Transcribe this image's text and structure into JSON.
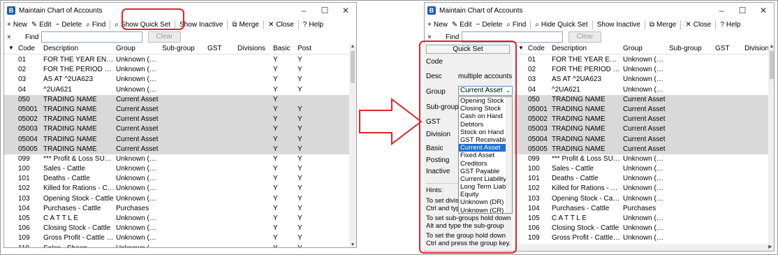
{
  "window_title": "Maintain Chart of Accounts",
  "app_icon_letter": "B",
  "toolbar_left": [
    {
      "icon": "+",
      "label": "New"
    },
    {
      "icon": "✎",
      "label": "Edit"
    },
    {
      "icon": "−",
      "label": "Delete"
    },
    {
      "icon": "⌕",
      "label": "Find"
    },
    {
      "icon": "⌕",
      "label": "Show Quick Set"
    },
    {
      "icon": "",
      "label": "Show Inactive"
    },
    {
      "icon": "⧉",
      "label": "Merge"
    },
    {
      "icon": "✕",
      "label": "Close"
    },
    {
      "icon": "?",
      "label": "Help"
    }
  ],
  "toolbar_right": [
    {
      "icon": "+",
      "label": "New"
    },
    {
      "icon": "✎",
      "label": "Edit"
    },
    {
      "icon": "−",
      "label": "Delete"
    },
    {
      "icon": "⌕",
      "label": "Find"
    },
    {
      "icon": "⌕",
      "label": "Hide Quick Set"
    },
    {
      "icon": "",
      "label": "Show Inactive"
    },
    {
      "icon": "⧉",
      "label": "Merge"
    },
    {
      "icon": "✕",
      "label": "Close"
    },
    {
      "icon": "?",
      "label": "Help"
    }
  ],
  "find": {
    "close": "×",
    "label": "Find",
    "value": "",
    "clear_label": "Clear"
  },
  "columns_left": [
    "Code",
    "Description",
    "Group",
    "Sub-group",
    "GST",
    "Divisions",
    "Basic",
    "Post"
  ],
  "columns_right": [
    "Code",
    "Description",
    "Group",
    "Sub-group",
    "GST",
    "Division"
  ],
  "rows_left": [
    {
      "code": "01",
      "desc": "FOR THE YEAR ENDED...",
      "group": "Unknown (DR)",
      "basic": "Y",
      "post": "Y",
      "sel": false
    },
    {
      "code": "02",
      "desc": "FOR THE PERIOD END...",
      "group": "Unknown (DR)",
      "basic": "Y",
      "post": "Y",
      "sel": false
    },
    {
      "code": "03",
      "desc": "AS AT ^2UA623",
      "group": "Unknown (DR)",
      "basic": "Y",
      "post": "Y",
      "sel": false
    },
    {
      "code": "04",
      "desc": "^2UA621",
      "group": "Unknown (DR)",
      "basic": "Y",
      "post": "Y",
      "sel": false
    },
    {
      "code": "050",
      "desc": "TRADING NAME",
      "group": "Current Asset",
      "basic": "Y",
      "post": "",
      "sel": true
    },
    {
      "code": "05001",
      "desc": "TRADING NAME",
      "group": "Current Asset",
      "basic": "Y",
      "post": "Y",
      "sel": true
    },
    {
      "code": "05002",
      "desc": "TRADING NAME",
      "group": "Current Asset",
      "basic": "Y",
      "post": "Y",
      "sel": true
    },
    {
      "code": "05003",
      "desc": "TRADING NAME",
      "group": "Current Asset",
      "basic": "Y",
      "post": "Y",
      "sel": true
    },
    {
      "code": "05004",
      "desc": "TRADING NAME",
      "group": "Current Asset",
      "basic": "Y",
      "post": "Y",
      "sel": true
    },
    {
      "code": "05005",
      "desc": "TRADING NAME",
      "group": "Current Asset",
      "basic": "Y",
      "post": "Y",
      "sel": true
    },
    {
      "code": "099",
      "desc": "*** Profit & Loss SUSP...",
      "group": "Unknown (DR)",
      "basic": "Y",
      "post": "Y",
      "sel": false
    },
    {
      "code": "100",
      "desc": "Sales - Cattle",
      "group": "Unknown (DR)",
      "basic": "Y",
      "post": "Y",
      "sel": false
    },
    {
      "code": "101",
      "desc": "Deaths - Cattle",
      "group": "Unknown (DR)",
      "basic": "Y",
      "post": "Y",
      "sel": false
    },
    {
      "code": "102",
      "desc": "Killed for Rations - Ca...",
      "group": "Unknown (DR)",
      "basic": "Y",
      "post": "Y",
      "sel": false
    },
    {
      "code": "103",
      "desc": "Opening Stock - Cattle",
      "group": "Unknown (DR)",
      "basic": "Y",
      "post": "Y",
      "sel": false
    },
    {
      "code": "104",
      "desc": "Purchases - Cattle",
      "group": "Purchases",
      "basic": "Y",
      "post": "Y",
      "sel": false
    },
    {
      "code": "105",
      "desc": "C A T T L E",
      "group": "Unknown (DR)",
      "basic": "Y",
      "post": "Y",
      "sel": false
    },
    {
      "code": "106",
      "desc": "Closing Stock - Cattle",
      "group": "Unknown (DR)",
      "basic": "Y",
      "post": "Y",
      "sel": false
    },
    {
      "code": "109",
      "desc": "Gross Profit - Cattle Tr...",
      "group": "Unknown (DR)",
      "basic": "Y",
      "post": "Y",
      "sel": false
    },
    {
      "code": "110",
      "desc": "Sales - Sheep",
      "group": "Unknown (DR)",
      "basic": "Y",
      "post": "Y",
      "sel": false
    }
  ],
  "rows_right": [
    {
      "code": "01",
      "desc": "FOR THE YEAR ENDED...",
      "group": "Unknown (DR)",
      "sel": false
    },
    {
      "code": "02",
      "desc": "FOR THE PERIOD END...",
      "group": "Unknown (DR)",
      "sel": false
    },
    {
      "code": "03",
      "desc": "AS AT ^2UA623",
      "group": "Unknown (DR)",
      "sel": false
    },
    {
      "code": "04",
      "desc": "^2UA621",
      "group": "Unknown (DR)",
      "sel": false
    },
    {
      "code": "050",
      "desc": "TRADING NAME",
      "group": "Current Asset",
      "sel": true
    },
    {
      "code": "05001",
      "desc": "TRADING NAME",
      "group": "Current Asset",
      "sel": true
    },
    {
      "code": "05002",
      "desc": "TRADING NAME",
      "group": "Current Asset",
      "sel": true
    },
    {
      "code": "05003",
      "desc": "TRADING NAME",
      "group": "Current Asset",
      "sel": true
    },
    {
      "code": "05004",
      "desc": "TRADING NAME",
      "group": "Current Asset",
      "sel": true
    },
    {
      "code": "05005",
      "desc": "TRADING NAME",
      "group": "Current Asset",
      "sel": true
    },
    {
      "code": "099",
      "desc": "*** Profit & Loss SUSP...",
      "group": "Unknown (DR)",
      "sel": false
    },
    {
      "code": "100",
      "desc": "Sales - Cattle",
      "group": "Unknown (DR)",
      "sel": false
    },
    {
      "code": "101",
      "desc": "Deaths - Cattle",
      "group": "Unknown (DR)",
      "sel": false
    },
    {
      "code": "102",
      "desc": "Killed for Rations - Ca...",
      "group": "Unknown (DR)",
      "sel": false
    },
    {
      "code": "103",
      "desc": "Opening Stock - Cattle",
      "group": "Unknown (DR)",
      "sel": false
    },
    {
      "code": "104",
      "desc": "Purchases - Cattle",
      "group": "Purchases",
      "sel": false
    },
    {
      "code": "105",
      "desc": "C A T T L E",
      "group": "Unknown (DR)",
      "sel": false
    },
    {
      "code": "106",
      "desc": "Closing Stock - Cattle",
      "group": "Unknown (DR)",
      "sel": false
    },
    {
      "code": "109",
      "desc": "Gross Profit - Cattle Tr...",
      "group": "Unknown (DR)",
      "sel": false
    }
  ],
  "quick_set": {
    "title": "Quick Set",
    "labels": {
      "code": "Code",
      "desc": "Desc",
      "group": "Group",
      "subgroup": "Sub-group",
      "gst": "GST",
      "division": "Division",
      "basic": "Basic",
      "posting": "Posting",
      "inactive": "Inactive"
    },
    "desc_value": "multiple accounts",
    "group_value": "Current Asset",
    "group_options": [
      "Opening Stock",
      "Closing Stock",
      "Cash on Hand",
      "Debtors",
      "Stock on Hand",
      "GST Receivable",
      "Current Asset",
      "Fixed Asset",
      "Creditors",
      "GST Payable",
      "Current Liability",
      "Long Term Liabi",
      "Equity",
      "Unknown (DR)",
      "Unknown (CR)"
    ],
    "group_selected": "Current Asset",
    "hints_title": "Hints:",
    "hint1": "To set divisi",
    "hint1b": "Ctrl and typ",
    "hint2": "To set sub-groups hold down Alt and type the sub-group",
    "hint3": "To set the group hold down Ctrl and press the group key."
  },
  "colors": {
    "highlight_red": "#e0232a",
    "selection_blue": "#1f6fd1",
    "row_selected": "#d9d9d9"
  }
}
